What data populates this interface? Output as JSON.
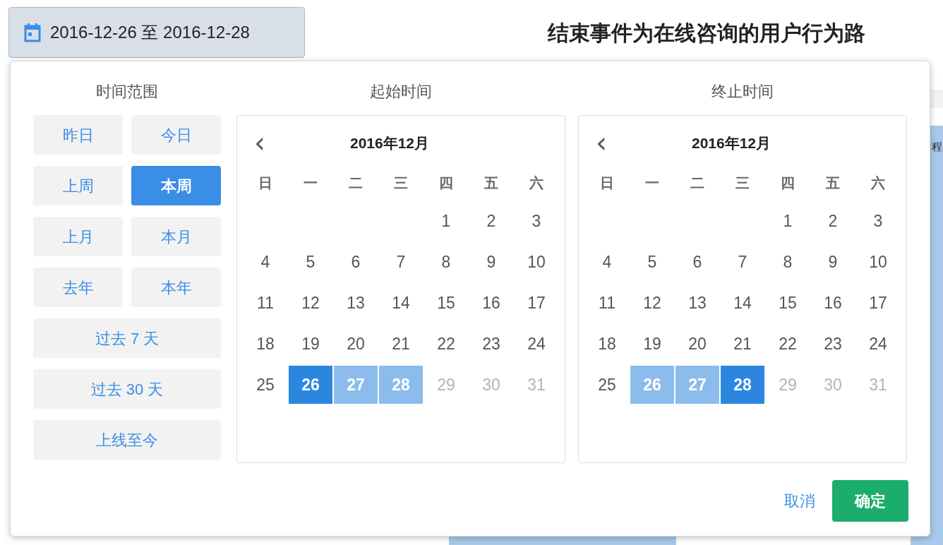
{
  "date_button": {
    "label": "2016-12-26 至 2016-12-28"
  },
  "page_title": "结束事件为在线咨询的用户行为路",
  "background_text": "程",
  "picker": {
    "presets_heading": "时间范围",
    "presets": [
      {
        "label": "昨日",
        "selected": false,
        "wide": false
      },
      {
        "label": "今日",
        "selected": false,
        "wide": false
      },
      {
        "label": "上周",
        "selected": false,
        "wide": false
      },
      {
        "label": "本周",
        "selected": true,
        "wide": false
      },
      {
        "label": "上月",
        "selected": false,
        "wide": false
      },
      {
        "label": "本月",
        "selected": false,
        "wide": false
      },
      {
        "label": "去年",
        "selected": false,
        "wide": false
      },
      {
        "label": "本年",
        "selected": false,
        "wide": false
      },
      {
        "label": "过去 7 天",
        "selected": false,
        "wide": true
      },
      {
        "label": "过去 30 天",
        "selected": false,
        "wide": true
      },
      {
        "label": "上线至今",
        "selected": false,
        "wide": true
      }
    ],
    "calendars": [
      {
        "heading": "起始时间",
        "prev": "‹",
        "month": "2016年12月",
        "weekdays": [
          "日",
          "一",
          "二",
          "三",
          "四",
          "五",
          "六"
        ],
        "weeks": [
          [
            {
              "day": "1",
              "selected": false,
              "in_range": false,
              "disabled": false
            },
            {
              "day": "2",
              "selected": false,
              "in_range": false,
              "disabled": false
            },
            {
              "day": "3",
              "selected": false,
              "in_range": false,
              "disabled": false
            }
          ],
          [
            {
              "day": "4",
              "selected": false,
              "in_range": false,
              "disabled": false
            },
            {
              "day": "5",
              "selected": false,
              "in_range": false,
              "disabled": false
            },
            {
              "day": "6",
              "selected": false,
              "in_range": false,
              "disabled": false
            },
            {
              "day": "7",
              "selected": false,
              "in_range": false,
              "disabled": false
            },
            {
              "day": "8",
              "selected": false,
              "in_range": false,
              "disabled": false
            },
            {
              "day": "9",
              "selected": false,
              "in_range": false,
              "disabled": false
            },
            {
              "day": "10",
              "selected": false,
              "in_range": false,
              "disabled": false
            }
          ],
          [
            {
              "day": "11",
              "selected": false,
              "in_range": false,
              "disabled": false
            },
            {
              "day": "12",
              "selected": false,
              "in_range": false,
              "disabled": false
            },
            {
              "day": "13",
              "selected": false,
              "in_range": false,
              "disabled": false
            },
            {
              "day": "14",
              "selected": false,
              "in_range": false,
              "disabled": false
            },
            {
              "day": "15",
              "selected": false,
              "in_range": false,
              "disabled": false
            },
            {
              "day": "16",
              "selected": false,
              "in_range": false,
              "disabled": false
            },
            {
              "day": "17",
              "selected": false,
              "in_range": false,
              "disabled": false
            }
          ],
          [
            {
              "day": "18",
              "selected": false,
              "in_range": false,
              "disabled": false
            },
            {
              "day": "19",
              "selected": false,
              "in_range": false,
              "disabled": false
            },
            {
              "day": "20",
              "selected": false,
              "in_range": false,
              "disabled": false
            },
            {
              "day": "21",
              "selected": false,
              "in_range": false,
              "disabled": false
            },
            {
              "day": "22",
              "selected": false,
              "in_range": false,
              "disabled": false
            },
            {
              "day": "23",
              "selected": false,
              "in_range": false,
              "disabled": false
            },
            {
              "day": "24",
              "selected": false,
              "in_range": false,
              "disabled": false
            }
          ],
          [
            {
              "day": "25",
              "selected": false,
              "in_range": false,
              "disabled": false
            },
            {
              "day": "26",
              "selected": true,
              "in_range": true,
              "disabled": false
            },
            {
              "day": "27",
              "selected": false,
              "in_range": true,
              "disabled": false
            },
            {
              "day": "28",
              "selected": false,
              "in_range": true,
              "disabled": false
            },
            {
              "day": "29",
              "selected": false,
              "in_range": false,
              "disabled": true
            },
            {
              "day": "30",
              "selected": false,
              "in_range": false,
              "disabled": true
            },
            {
              "day": "31",
              "selected": false,
              "in_range": false,
              "disabled": true
            }
          ]
        ]
      },
      {
        "heading": "终止时间",
        "prev": "‹",
        "month": "2016年12月",
        "weekdays": [
          "日",
          "一",
          "二",
          "三",
          "四",
          "五",
          "六"
        ],
        "weeks": [
          [
            {
              "day": "1",
              "selected": false,
              "in_range": false,
              "disabled": false
            },
            {
              "day": "2",
              "selected": false,
              "in_range": false,
              "disabled": false
            },
            {
              "day": "3",
              "selected": false,
              "in_range": false,
              "disabled": false
            }
          ],
          [
            {
              "day": "4",
              "selected": false,
              "in_range": false,
              "disabled": false
            },
            {
              "day": "5",
              "selected": false,
              "in_range": false,
              "disabled": false
            },
            {
              "day": "6",
              "selected": false,
              "in_range": false,
              "disabled": false
            },
            {
              "day": "7",
              "selected": false,
              "in_range": false,
              "disabled": false
            },
            {
              "day": "8",
              "selected": false,
              "in_range": false,
              "disabled": false
            },
            {
              "day": "9",
              "selected": false,
              "in_range": false,
              "disabled": false
            },
            {
              "day": "10",
              "selected": false,
              "in_range": false,
              "disabled": false
            }
          ],
          [
            {
              "day": "11",
              "selected": false,
              "in_range": false,
              "disabled": false
            },
            {
              "day": "12",
              "selected": false,
              "in_range": false,
              "disabled": false
            },
            {
              "day": "13",
              "selected": false,
              "in_range": false,
              "disabled": false
            },
            {
              "day": "14",
              "selected": false,
              "in_range": false,
              "disabled": false
            },
            {
              "day": "15",
              "selected": false,
              "in_range": false,
              "disabled": false
            },
            {
              "day": "16",
              "selected": false,
              "in_range": false,
              "disabled": false
            },
            {
              "day": "17",
              "selected": false,
              "in_range": false,
              "disabled": false
            }
          ],
          [
            {
              "day": "18",
              "selected": false,
              "in_range": false,
              "disabled": false
            },
            {
              "day": "19",
              "selected": false,
              "in_range": false,
              "disabled": false
            },
            {
              "day": "20",
              "selected": false,
              "in_range": false,
              "disabled": false
            },
            {
              "day": "21",
              "selected": false,
              "in_range": false,
              "disabled": false
            },
            {
              "day": "22",
              "selected": false,
              "in_range": false,
              "disabled": false
            },
            {
              "day": "23",
              "selected": false,
              "in_range": false,
              "disabled": false
            },
            {
              "day": "24",
              "selected": false,
              "in_range": false,
              "disabled": false
            }
          ],
          [
            {
              "day": "25",
              "selected": false,
              "in_range": false,
              "disabled": false
            },
            {
              "day": "26",
              "selected": false,
              "in_range": true,
              "disabled": false
            },
            {
              "day": "27",
              "selected": false,
              "in_range": true,
              "disabled": false
            },
            {
              "day": "28",
              "selected": true,
              "in_range": true,
              "disabled": false
            },
            {
              "day": "29",
              "selected": false,
              "in_range": false,
              "disabled": true
            },
            {
              "day": "30",
              "selected": false,
              "in_range": false,
              "disabled": true
            },
            {
              "day": "31",
              "selected": false,
              "in_range": false,
              "disabled": true
            }
          ]
        ]
      }
    ],
    "cancel": "取消",
    "confirm": "确定"
  }
}
